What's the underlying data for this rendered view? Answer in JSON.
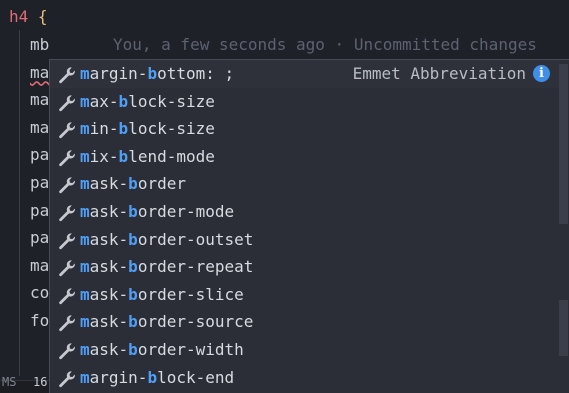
{
  "editor": {
    "selector": "h4",
    "open_brace": "{",
    "lines": [
      "mb",
      "ma",
      "ma",
      "ma",
      "pa",
      "pa",
      "pa",
      "pa",
      "ma",
      "co",
      "fo"
    ],
    "codelens": "You, a few seconds ago · Uncommitted changes"
  },
  "suggest": {
    "detail": "Emmet Abbreviation",
    "info_icon": "i",
    "items": [
      {
        "pre": "",
        "h1": "m",
        "mid": "argin-",
        "h2": "b",
        "post": "ottom: ;"
      },
      {
        "pre": "",
        "h1": "m",
        "mid": "ax-",
        "h2": "b",
        "post": "lock-size"
      },
      {
        "pre": "",
        "h1": "m",
        "mid": "in-",
        "h2": "b",
        "post": "lock-size"
      },
      {
        "pre": "",
        "h1": "m",
        "mid": "ix-",
        "h2": "b",
        "post": "lend-mode"
      },
      {
        "pre": "",
        "h1": "m",
        "mid": "ask-",
        "h2": "b",
        "post": "order"
      },
      {
        "pre": "",
        "h1": "m",
        "mid": "ask-",
        "h2": "b",
        "post": "order-mode"
      },
      {
        "pre": "",
        "h1": "m",
        "mid": "ask-",
        "h2": "b",
        "post": "order-outset"
      },
      {
        "pre": "",
        "h1": "m",
        "mid": "ask-",
        "h2": "b",
        "post": "order-repeat"
      },
      {
        "pre": "",
        "h1": "m",
        "mid": "ask-",
        "h2": "b",
        "post": "order-slice"
      },
      {
        "pre": "",
        "h1": "m",
        "mid": "ask-",
        "h2": "b",
        "post": "order-source"
      },
      {
        "pre": "",
        "h1": "m",
        "mid": "ask-",
        "h2": "b",
        "post": "order-width"
      },
      {
        "pre": "",
        "h1": "m",
        "mid": "argin-",
        "h2": "b",
        "post": "lock-end"
      }
    ]
  },
  "footer": {
    "left": "MS",
    "num": "16"
  },
  "colors": {
    "accent": "#4f9ef7",
    "tag": "#e06c75",
    "brace": "#e5c07b"
  }
}
